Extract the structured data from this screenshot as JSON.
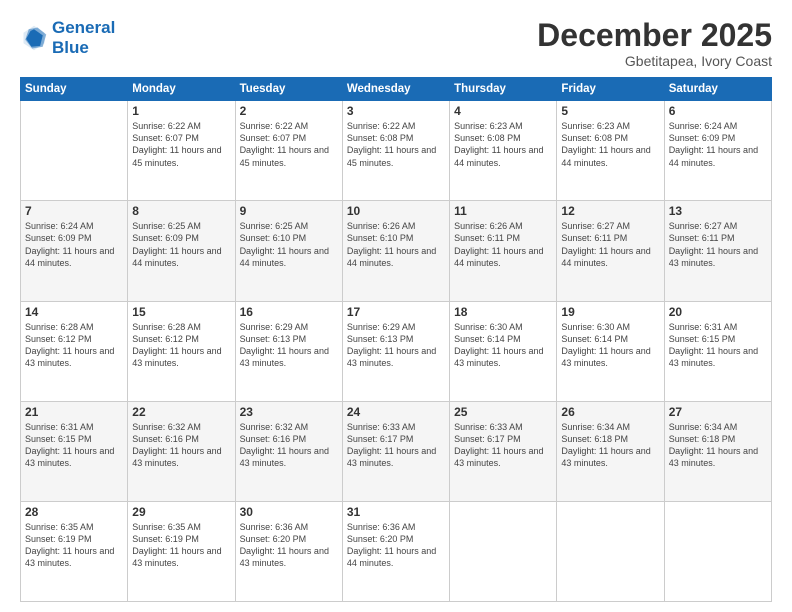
{
  "header": {
    "logo_line1": "General",
    "logo_line2": "Blue",
    "month_title": "December 2025",
    "location": "Gbetitapea, Ivory Coast"
  },
  "weekdays": [
    "Sunday",
    "Monday",
    "Tuesday",
    "Wednesday",
    "Thursday",
    "Friday",
    "Saturday"
  ],
  "weeks": [
    [
      {
        "day": "",
        "sunrise": "",
        "sunset": "",
        "daylight": ""
      },
      {
        "day": "1",
        "sunrise": "Sunrise: 6:22 AM",
        "sunset": "Sunset: 6:07 PM",
        "daylight": "Daylight: 11 hours and 45 minutes."
      },
      {
        "day": "2",
        "sunrise": "Sunrise: 6:22 AM",
        "sunset": "Sunset: 6:07 PM",
        "daylight": "Daylight: 11 hours and 45 minutes."
      },
      {
        "day": "3",
        "sunrise": "Sunrise: 6:22 AM",
        "sunset": "Sunset: 6:08 PM",
        "daylight": "Daylight: 11 hours and 45 minutes."
      },
      {
        "day": "4",
        "sunrise": "Sunrise: 6:23 AM",
        "sunset": "Sunset: 6:08 PM",
        "daylight": "Daylight: 11 hours and 44 minutes."
      },
      {
        "day": "5",
        "sunrise": "Sunrise: 6:23 AM",
        "sunset": "Sunset: 6:08 PM",
        "daylight": "Daylight: 11 hours and 44 minutes."
      },
      {
        "day": "6",
        "sunrise": "Sunrise: 6:24 AM",
        "sunset": "Sunset: 6:09 PM",
        "daylight": "Daylight: 11 hours and 44 minutes."
      }
    ],
    [
      {
        "day": "7",
        "sunrise": "Sunrise: 6:24 AM",
        "sunset": "Sunset: 6:09 PM",
        "daylight": "Daylight: 11 hours and 44 minutes."
      },
      {
        "day": "8",
        "sunrise": "Sunrise: 6:25 AM",
        "sunset": "Sunset: 6:09 PM",
        "daylight": "Daylight: 11 hours and 44 minutes."
      },
      {
        "day": "9",
        "sunrise": "Sunrise: 6:25 AM",
        "sunset": "Sunset: 6:10 PM",
        "daylight": "Daylight: 11 hours and 44 minutes."
      },
      {
        "day": "10",
        "sunrise": "Sunrise: 6:26 AM",
        "sunset": "Sunset: 6:10 PM",
        "daylight": "Daylight: 11 hours and 44 minutes."
      },
      {
        "day": "11",
        "sunrise": "Sunrise: 6:26 AM",
        "sunset": "Sunset: 6:11 PM",
        "daylight": "Daylight: 11 hours and 44 minutes."
      },
      {
        "day": "12",
        "sunrise": "Sunrise: 6:27 AM",
        "sunset": "Sunset: 6:11 PM",
        "daylight": "Daylight: 11 hours and 44 minutes."
      },
      {
        "day": "13",
        "sunrise": "Sunrise: 6:27 AM",
        "sunset": "Sunset: 6:11 PM",
        "daylight": "Daylight: 11 hours and 43 minutes."
      }
    ],
    [
      {
        "day": "14",
        "sunrise": "Sunrise: 6:28 AM",
        "sunset": "Sunset: 6:12 PM",
        "daylight": "Daylight: 11 hours and 43 minutes."
      },
      {
        "day": "15",
        "sunrise": "Sunrise: 6:28 AM",
        "sunset": "Sunset: 6:12 PM",
        "daylight": "Daylight: 11 hours and 43 minutes."
      },
      {
        "day": "16",
        "sunrise": "Sunrise: 6:29 AM",
        "sunset": "Sunset: 6:13 PM",
        "daylight": "Daylight: 11 hours and 43 minutes."
      },
      {
        "day": "17",
        "sunrise": "Sunrise: 6:29 AM",
        "sunset": "Sunset: 6:13 PM",
        "daylight": "Daylight: 11 hours and 43 minutes."
      },
      {
        "day": "18",
        "sunrise": "Sunrise: 6:30 AM",
        "sunset": "Sunset: 6:14 PM",
        "daylight": "Daylight: 11 hours and 43 minutes."
      },
      {
        "day": "19",
        "sunrise": "Sunrise: 6:30 AM",
        "sunset": "Sunset: 6:14 PM",
        "daylight": "Daylight: 11 hours and 43 minutes."
      },
      {
        "day": "20",
        "sunrise": "Sunrise: 6:31 AM",
        "sunset": "Sunset: 6:15 PM",
        "daylight": "Daylight: 11 hours and 43 minutes."
      }
    ],
    [
      {
        "day": "21",
        "sunrise": "Sunrise: 6:31 AM",
        "sunset": "Sunset: 6:15 PM",
        "daylight": "Daylight: 11 hours and 43 minutes."
      },
      {
        "day": "22",
        "sunrise": "Sunrise: 6:32 AM",
        "sunset": "Sunset: 6:16 PM",
        "daylight": "Daylight: 11 hours and 43 minutes."
      },
      {
        "day": "23",
        "sunrise": "Sunrise: 6:32 AM",
        "sunset": "Sunset: 6:16 PM",
        "daylight": "Daylight: 11 hours and 43 minutes."
      },
      {
        "day": "24",
        "sunrise": "Sunrise: 6:33 AM",
        "sunset": "Sunset: 6:17 PM",
        "daylight": "Daylight: 11 hours and 43 minutes."
      },
      {
        "day": "25",
        "sunrise": "Sunrise: 6:33 AM",
        "sunset": "Sunset: 6:17 PM",
        "daylight": "Daylight: 11 hours and 43 minutes."
      },
      {
        "day": "26",
        "sunrise": "Sunrise: 6:34 AM",
        "sunset": "Sunset: 6:18 PM",
        "daylight": "Daylight: 11 hours and 43 minutes."
      },
      {
        "day": "27",
        "sunrise": "Sunrise: 6:34 AM",
        "sunset": "Sunset: 6:18 PM",
        "daylight": "Daylight: 11 hours and 43 minutes."
      }
    ],
    [
      {
        "day": "28",
        "sunrise": "Sunrise: 6:35 AM",
        "sunset": "Sunset: 6:19 PM",
        "daylight": "Daylight: 11 hours and 43 minutes."
      },
      {
        "day": "29",
        "sunrise": "Sunrise: 6:35 AM",
        "sunset": "Sunset: 6:19 PM",
        "daylight": "Daylight: 11 hours and 43 minutes."
      },
      {
        "day": "30",
        "sunrise": "Sunrise: 6:36 AM",
        "sunset": "Sunset: 6:20 PM",
        "daylight": "Daylight: 11 hours and 43 minutes."
      },
      {
        "day": "31",
        "sunrise": "Sunrise: 6:36 AM",
        "sunset": "Sunset: 6:20 PM",
        "daylight": "Daylight: 11 hours and 44 minutes."
      },
      {
        "day": "",
        "sunrise": "",
        "sunset": "",
        "daylight": ""
      },
      {
        "day": "",
        "sunrise": "",
        "sunset": "",
        "daylight": ""
      },
      {
        "day": "",
        "sunrise": "",
        "sunset": "",
        "daylight": ""
      }
    ]
  ]
}
